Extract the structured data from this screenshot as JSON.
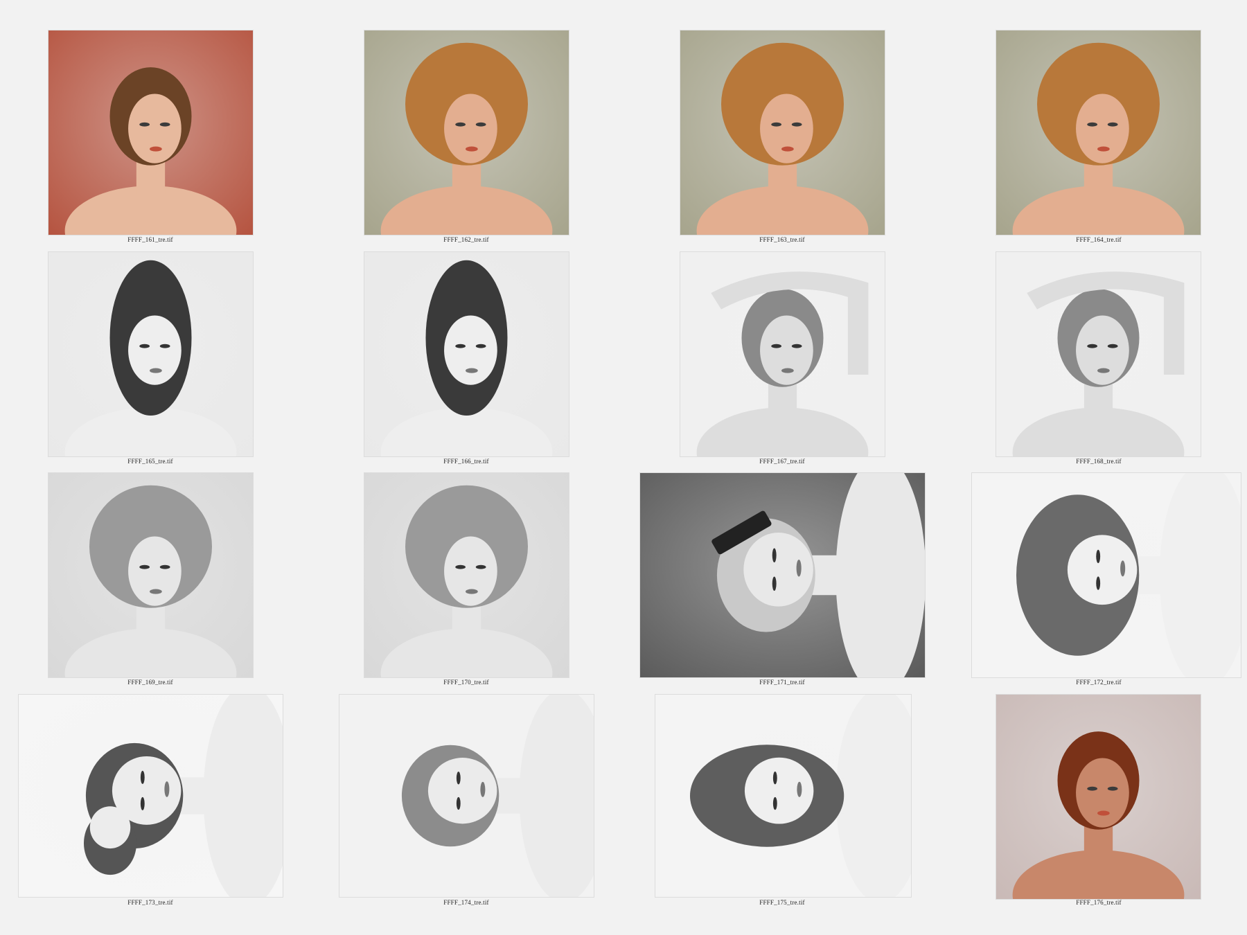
{
  "contact_sheet": {
    "items": [
      {
        "filename": "FFFF_161_tre.tif",
        "tone": "color",
        "bg": "#b5533f",
        "hair": "#6b4326",
        "skin": "#e7b99d",
        "subject": "woman-profile-looking-up"
      },
      {
        "filename": "FFFF_162_tre.tif",
        "tone": "color",
        "bg": "#a6a48c",
        "hair": "#b8783a",
        "skin": "#e3ae90",
        "subject": "woman-voluminous-auburn-hair"
      },
      {
        "filename": "FFFF_163_tre.tif",
        "tone": "color",
        "bg": "#a6a48c",
        "hair": "#b8783a",
        "skin": "#e3ae90",
        "subject": "woman-voluminous-auburn-hair"
      },
      {
        "filename": "FFFF_164_tre.tif",
        "tone": "color",
        "bg": "#a6a48c",
        "hair": "#b8783a",
        "skin": "#e3ae90",
        "subject": "woman-voluminous-auburn-hair"
      },
      {
        "filename": "FFFF_165_tre.tif",
        "tone": "bw",
        "bg": "#e9e9e9",
        "hair": "#3a3a3a",
        "skin": "#eeeeee",
        "subject": "woman-long-straight-hair-profile"
      },
      {
        "filename": "FFFF_166_tre.tif",
        "tone": "bw",
        "bg": "#e9e9e9",
        "hair": "#3a3a3a",
        "skin": "#eeeeee",
        "subject": "woman-long-straight-hair-profile"
      },
      {
        "filename": "FFFF_167_tre.tif",
        "tone": "bw",
        "bg": "#f0f0f0",
        "hair": "#8a8a8a",
        "skin": "#dddddd",
        "subject": "woman-arm-raised"
      },
      {
        "filename": "FFFF_168_tre.tif",
        "tone": "bw",
        "bg": "#f0f0f0",
        "hair": "#8a8a8a",
        "skin": "#dddddd",
        "subject": "woman-arm-raised"
      },
      {
        "filename": "FFFF_169_tre.tif",
        "tone": "bw",
        "bg": "#d8d8d8",
        "hair": "#9a9a9a",
        "skin": "#e6e6e6",
        "subject": "woman-curly-hair-profile"
      },
      {
        "filename": "FFFF_170_tre.tif",
        "tone": "bw",
        "bg": "#d8d8d8",
        "hair": "#9a9a9a",
        "skin": "#e6e6e6",
        "subject": "woman-curly-hair-profile"
      },
      {
        "filename": "FFFF_171_tre.tif",
        "tone": "bw",
        "bg": "#5a5a5a",
        "hair": "#c9c9c9",
        "skin": "#e8e8e8",
        "subject": "woman-with-phone-rotated"
      },
      {
        "filename": "FFFF_172_tre.tif",
        "tone": "bw",
        "bg": "#f4f4f4",
        "hair": "#6a6a6a",
        "skin": "#f0f0f0",
        "subject": "woman-updo-rotated"
      },
      {
        "filename": "FFFF_173_tre.tif",
        "tone": "bw",
        "bg": "#f6f6f6",
        "hair": "#555555",
        "skin": "#ececec",
        "subject": "two-women-rotated"
      },
      {
        "filename": "FFFF_174_tre.tif",
        "tone": "bw",
        "bg": "#f2f2f2",
        "hair": "#8c8c8c",
        "skin": "#ebebeb",
        "subject": "woman-finger-waves-rotated"
      },
      {
        "filename": "FFFF_175_tre.tif",
        "tone": "bw",
        "bg": "#f4f4f4",
        "hair": "#5e5e5e",
        "skin": "#efefef",
        "subject": "woman-long-hair-rotated"
      },
      {
        "filename": "FFFF_176_tre.tif",
        "tone": "color",
        "bg": "#c9b9b6",
        "hair": "#7a3218",
        "skin": "#c8876a",
        "subject": "woman-red-hair-profile"
      }
    ]
  }
}
